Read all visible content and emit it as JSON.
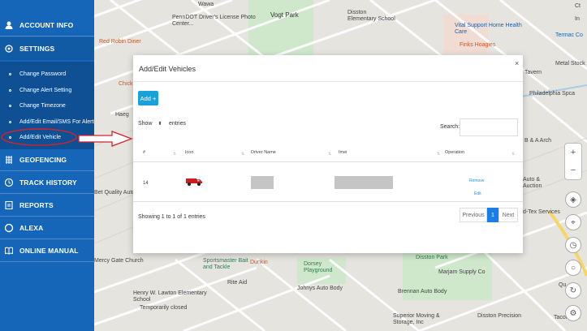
{
  "sidebar": {
    "items": [
      {
        "label": "ACCOUNT INFO",
        "icon": "person-icon"
      },
      {
        "label": "SETTINGS",
        "icon": "gear-icon"
      },
      {
        "label": "GEOFENCING",
        "icon": "fence-icon"
      },
      {
        "label": "TRACK HISTORY",
        "icon": "history-icon"
      },
      {
        "label": "REPORTS",
        "icon": "report-icon"
      },
      {
        "label": "ALEXA",
        "icon": "alexa-icon"
      },
      {
        "label": "ONLINE MANUAL",
        "icon": "manual-icon"
      }
    ],
    "submenu": [
      {
        "label": "Change Password"
      },
      {
        "label": "Change Alert Setting"
      },
      {
        "label": "Change Timezone"
      },
      {
        "label": "Add/Edit Email/SMS For Alerts"
      },
      {
        "label": "Add/Edit Vehicle"
      }
    ]
  },
  "map": {
    "labels": [
      "PennDOT Driver's License Photo Center...",
      "Red Robin Diner",
      "Vogt Park",
      "Disston Elementary School",
      "Vital Support Home Health Care",
      "Finks Hoagies",
      "Termac Co",
      "Metal Stock",
      "Philadelphia Spca",
      "Tavern",
      "Chick",
      "Haeg",
      "Bet Quality Auto",
      "B & A Arch",
      "Auto & Auction",
      "d-Tex Services",
      "Mercy Gate Church",
      "Sportsmaster Bait and Tackle",
      "Dunkin",
      "Dorsey Playground",
      "Disston Park",
      "Marjam Supply Co",
      "Henry W. Lawton Elementary School",
      "Temporarily closed",
      "Rite Aid",
      "Johnys Auto Body",
      "Brennan Auto Body",
      "Qu",
      "Superior Moving & Storage, Inc",
      "Disston Precision",
      "Tacony Bo",
      "Wawa",
      "Ct",
      "In"
    ],
    "colors": {
      "park": "#c8e6c9",
      "road": "#ffffff",
      "background": "#e6e4df"
    }
  },
  "modal": {
    "title": "Add/Edit Vehicles",
    "close": "×",
    "add_button": "Add +",
    "show_label": "Show",
    "page_size": "10",
    "entries_label": "entries",
    "search_label": "Search:",
    "search_value": "",
    "columns": [
      "#",
      "Icon",
      "Driver Name",
      "Imei",
      "Operation"
    ],
    "rows": [
      {
        "index": "14",
        "icon": "red-truck-icon",
        "driver_name": "",
        "imei": "",
        "remove_label": "Remove",
        "edit_label": "Edit"
      }
    ],
    "info": "Showing 1 to 1 of 1 entries",
    "pagination": {
      "previous": "Previous",
      "current": "1",
      "next": "Next"
    }
  },
  "colors": {
    "sidebar": "#1565b8",
    "submenu": "#0f4f94",
    "accent": "#17a2d9",
    "annotation": "#d2232a",
    "page_active": "#1b7de6"
  }
}
